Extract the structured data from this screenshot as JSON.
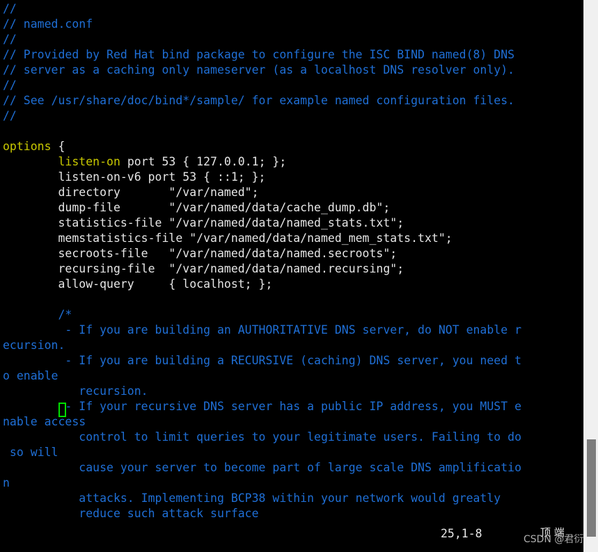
{
  "app": {
    "name": "vim",
    "file_name": "named.conf",
    "background_color": "#000000",
    "comment_color": "#1f6fd6",
    "keyword_color": "#c9c900",
    "text_color": "#e6e6e6",
    "cursor_color": "#00e000"
  },
  "editor": {
    "lines": [
      {
        "text": "//",
        "style": "comment"
      },
      {
        "text": "// named.conf",
        "style": "comment"
      },
      {
        "text": "//",
        "style": "comment"
      },
      {
        "text": "// Provided by Red Hat bind package to configure the ISC BIND named(8) DNS",
        "style": "comment"
      },
      {
        "text": "// server as a caching only nameserver (as a localhost DNS resolver only).",
        "style": "comment"
      },
      {
        "text": "//",
        "style": "comment"
      },
      {
        "text": "// See /usr/share/doc/bind*/sample/ for example named configuration files.",
        "style": "comment"
      },
      {
        "text": "//",
        "style": "comment"
      },
      {
        "text": "",
        "style": "blank"
      },
      {
        "text": "options {",
        "style": "keyword_head",
        "keyword": "options",
        "rest": " {"
      },
      {
        "text": "        listen-on port 53 { 127.0.0.1; };",
        "style": "keyword_indent",
        "indent": "        ",
        "keyword": "listen-on",
        "rest": " port 53 { 127.0.0.1; };"
      },
      {
        "text": "        listen-on-v6 port 53 { ::1; };",
        "style": "normal"
      },
      {
        "text": "        directory       \"/var/named\";",
        "style": "normal"
      },
      {
        "text": "        dump-file       \"/var/named/data/cache_dump.db\";",
        "style": "normal"
      },
      {
        "text": "        statistics-file \"/var/named/data/named_stats.txt\";",
        "style": "normal"
      },
      {
        "text": "        memstatistics-file \"/var/named/data/named_mem_stats.txt\";",
        "style": "normal"
      },
      {
        "text": "        secroots-file   \"/var/named/data/named.secroots\";",
        "style": "normal"
      },
      {
        "text": "        recursing-file  \"/var/named/data/named.recursing\";",
        "style": "normal"
      },
      {
        "text": "        allow-query     { localhost; };",
        "style": "normal"
      },
      {
        "text": "",
        "style": "blank"
      },
      {
        "text": "        /*",
        "style": "comment"
      },
      {
        "text": "         - If you are building an AUTHORITATIVE DNS server, do NOT enable r",
        "style": "comment"
      },
      {
        "text": "ecursion.",
        "style": "comment"
      },
      {
        "text": "         - If you are building a RECURSIVE (caching) DNS server, you need t",
        "style": "comment"
      },
      {
        "text": "o enable",
        "style": "comment"
      },
      {
        "text": "           recursion.",
        "style": "comment"
      },
      {
        "text": "         - If your recursive DNS server has a public IP address, you MUST e",
        "style": "comment"
      },
      {
        "text": "nable access",
        "style": "comment"
      },
      {
        "text": "           control to limit queries to your legitimate users. Failing to do",
        "style": "comment"
      },
      {
        "text": " so will",
        "style": "comment"
      },
      {
        "text": "           cause your server to become part of large scale DNS amplificatio",
        "style": "comment"
      },
      {
        "text": "n",
        "style": "comment"
      },
      {
        "text": "           attacks. Implementing BCP38 within your network would greatly",
        "style": "comment"
      },
      {
        "text": "           reduce such attack surface",
        "style": "comment"
      }
    ]
  },
  "cursor": {
    "line_number": 25,
    "column_display": "1-8"
  },
  "status": {
    "ruler": "25,1-8",
    "file_position": "顶 端"
  },
  "watermark": {
    "text": "CSDN @君衍."
  },
  "scrollbar": {
    "orientation": "vertical",
    "track_color": "#f0f0f0",
    "thumb_color": "#7d7d7d"
  }
}
